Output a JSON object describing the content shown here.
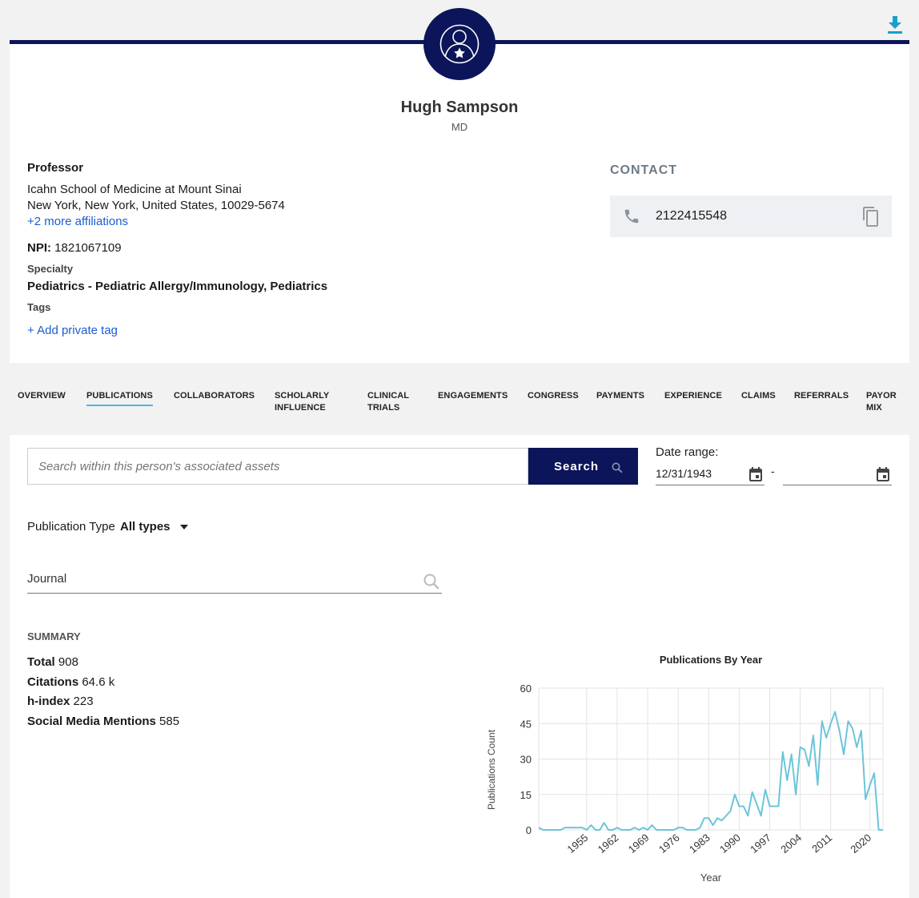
{
  "profile": {
    "name": "Hugh Sampson",
    "degree": "MD",
    "role": "Professor",
    "affiliation_line1": "Icahn School of Medicine at Mount Sinai",
    "affiliation_line2": "New York, New York, United States, 10029-5674",
    "more_affiliations": "+2 more affiliations",
    "npi_label": "NPI:",
    "npi_value": "1821067109",
    "specialty_label": "Specialty",
    "specialty_value": "Pediatrics - Pediatric Allergy/Immunology, Pediatrics",
    "tags_label": "Tags",
    "add_tag": "+ Add private tag"
  },
  "contact": {
    "title": "CONTACT",
    "phone": "2122415548"
  },
  "tabs": [
    {
      "line1": "OVERVIEW",
      "line2": ""
    },
    {
      "line1": "PUBLICATIONS",
      "line2": ""
    },
    {
      "line1": "COLLABORATORS",
      "line2": ""
    },
    {
      "line1": "SCHOLARLY",
      "line2": "INFLUENCE"
    },
    {
      "line1": "CLINICAL",
      "line2": "TRIALS"
    },
    {
      "line1": "ENGAGEMENTS",
      "line2": ""
    },
    {
      "line1": "CONGRESS",
      "line2": ""
    },
    {
      "line1": "PAYMENTS",
      "line2": ""
    },
    {
      "line1": "EXPERIENCE",
      "line2": ""
    },
    {
      "line1": "CLAIMS",
      "line2": ""
    },
    {
      "line1": "REFERRALS",
      "line2": ""
    },
    {
      "line1": "PAYOR",
      "line2": "MIX"
    }
  ],
  "search": {
    "placeholder": "Search within this person's associated assets",
    "button": "Search"
  },
  "date_range": {
    "label": "Date range:",
    "start": "12/31/1943",
    "separator": "-",
    "end": ""
  },
  "publication_type": {
    "label": "Publication Type",
    "value": "All types"
  },
  "journal": {
    "label": "Journal"
  },
  "summary": {
    "title": "SUMMARY",
    "total_label": "Total",
    "total_value": "908",
    "citations_label": "Citations",
    "citations_value": "64.6 k",
    "hindex_label": "h-index",
    "hindex_value": "223",
    "social_label": "Social Media Mentions",
    "social_value": "585"
  },
  "colors": {
    "navy": "#0c1559",
    "link": "#1a5dd1",
    "accent": "#4db8d8",
    "line": "#6cc5d9"
  },
  "icons": {
    "download": "download-icon",
    "avatar": "doctor-avatar-icon",
    "phone": "phone-icon",
    "copy": "copy-icon",
    "search": "search-icon",
    "calendar": "calendar-icon"
  },
  "chart_data": {
    "type": "line",
    "title": "Publications By Year",
    "xlabel": "Year",
    "ylabel": "Publications Count",
    "xlim": [
      1944,
      2023
    ],
    "ylim": [
      0,
      60
    ],
    "yticks": [
      0,
      15,
      30,
      45,
      60
    ],
    "xticks": [
      1955,
      1962,
      1969,
      1976,
      1983,
      1990,
      1997,
      2004,
      2011,
      2020
    ],
    "grid": true,
    "series": [
      {
        "x": [
          1944,
          1945,
          1946,
          1947,
          1948,
          1949,
          1950,
          1951,
          1952,
          1953,
          1954,
          1955,
          1956,
          1957,
          1958,
          1959,
          1960,
          1961,
          1962,
          1963,
          1964,
          1965,
          1966,
          1967,
          1968,
          1969,
          1970,
          1971,
          1972,
          1973,
          1974,
          1975,
          1976,
          1977,
          1978,
          1979,
          1980,
          1981,
          1982,
          1983,
          1984,
          1985,
          1986,
          1987,
          1988,
          1989,
          1990,
          1991,
          1992,
          1993,
          1994,
          1995,
          1996,
          1997,
          1998,
          1999,
          2000,
          2001,
          2002,
          2003,
          2004,
          2005,
          2006,
          2007,
          2008,
          2009,
          2010,
          2011,
          2012,
          2013,
          2014,
          2015,
          2016,
          2017,
          2018,
          2019,
          2020,
          2021,
          2022,
          2023
        ],
        "y": [
          1,
          0,
          0,
          0,
          0,
          0,
          1,
          1,
          1,
          1,
          1,
          0,
          2,
          0,
          0,
          3,
          0,
          0,
          1,
          0,
          0,
          0,
          1,
          0,
          1,
          0,
          2,
          0,
          0,
          0,
          0,
          0,
          1,
          1,
          0,
          0,
          0,
          1,
          5,
          5,
          2,
          5,
          4,
          6,
          8,
          15,
          10,
          10,
          6,
          16,
          11,
          6,
          17,
          10,
          10,
          10,
          33,
          21,
          32,
          15,
          35,
          34,
          27,
          40,
          19,
          46,
          39,
          45,
          50,
          42,
          32,
          46,
          43,
          35,
          42,
          13,
          19,
          24,
          0,
          0
        ]
      }
    ]
  }
}
